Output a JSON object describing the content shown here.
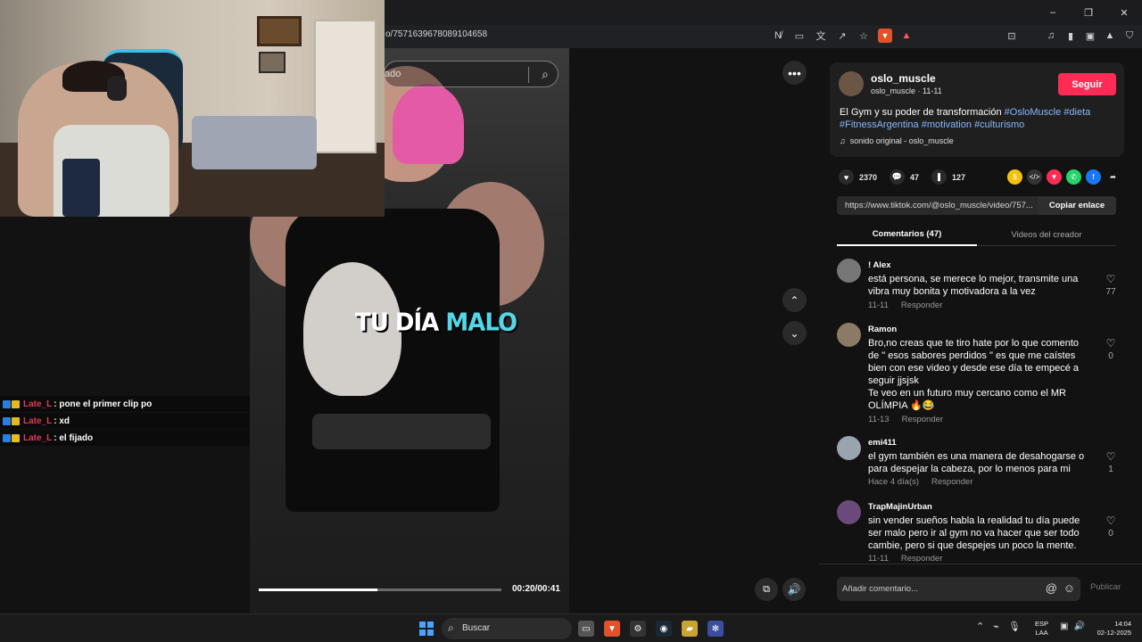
{
  "browser": {
    "url": "o/7571639678089104658",
    "window_controls": [
      "–",
      "❐",
      "✕"
    ]
  },
  "video": {
    "search_text": "ado",
    "caption_white": "TU DÍA",
    "caption_accent": "MALO",
    "progress": 0.49,
    "time": "00:20/00:41"
  },
  "chat": [
    {
      "user": "Late_L",
      "message": ": pone el primer clip po"
    },
    {
      "user": "Late_L",
      "message": ": xd"
    },
    {
      "user": "Late_L",
      "message": ": el fijado"
    }
  ],
  "post": {
    "username": "oslo_muscle",
    "subline": "oslo_muscle · 11-11",
    "follow_label": "Seguir",
    "description_text": "El Gym y su poder de transformación ",
    "hashtags": [
      "#OsloMuscle",
      "#dieta",
      "#FitnessArgentina",
      "#motivation",
      "#culturismo"
    ],
    "sound": "sonido original - oslo_muscle",
    "likes": "2370",
    "comments": "47",
    "saves": "127",
    "link": "https://www.tiktok.com/@oslo_muscle/video/757...",
    "copy_label": "Copiar enlace",
    "tab_comments": "Comentarios (47)",
    "tab_creator": "Videos del creador"
  },
  "comments": [
    {
      "user": "! Alex",
      "text": "está persona, se merece lo mejor, transmite una vibra muy bonita y motivadora a la vez",
      "date": "11-11",
      "reply": "Responder",
      "likes": "77"
    },
    {
      "user": "Ramon",
      "text": "Bro,no creas que te tiro hate por lo que comento de \" esos sabores perdidos \" es que me caístes bien con ese video y desde ese día te empecé a seguir jjsjsk\nTe veo en un futuro muy cercano como el MR OLÍMPIA 🔥😂",
      "date": "11-13",
      "reply": "Responder",
      "likes": "0"
    },
    {
      "user": "emi411",
      "text": "el gym también es una manera de desahogarse o para despejar la cabeza, por lo menos para mi",
      "date": "Hace 4 día(s)",
      "reply": "Responder",
      "likes": "1"
    },
    {
      "user": "TrapMajinUrban",
      "text": "sin vender sueños habla la realidad tu día puede ser malo pero ir al gym no va hacer que ser todo cambie, pero si que despejes un poco la mente.",
      "date": "11-11",
      "reply": "Responder",
      "likes": "0"
    }
  ],
  "comment_input": {
    "placeholder": "Añadir comentario...",
    "post_label": "Publicar"
  },
  "taskbar": {
    "search": "Buscar",
    "lang1": "ESP",
    "lang2": "LAA",
    "time": "14:04",
    "date": "02-12-2025"
  }
}
